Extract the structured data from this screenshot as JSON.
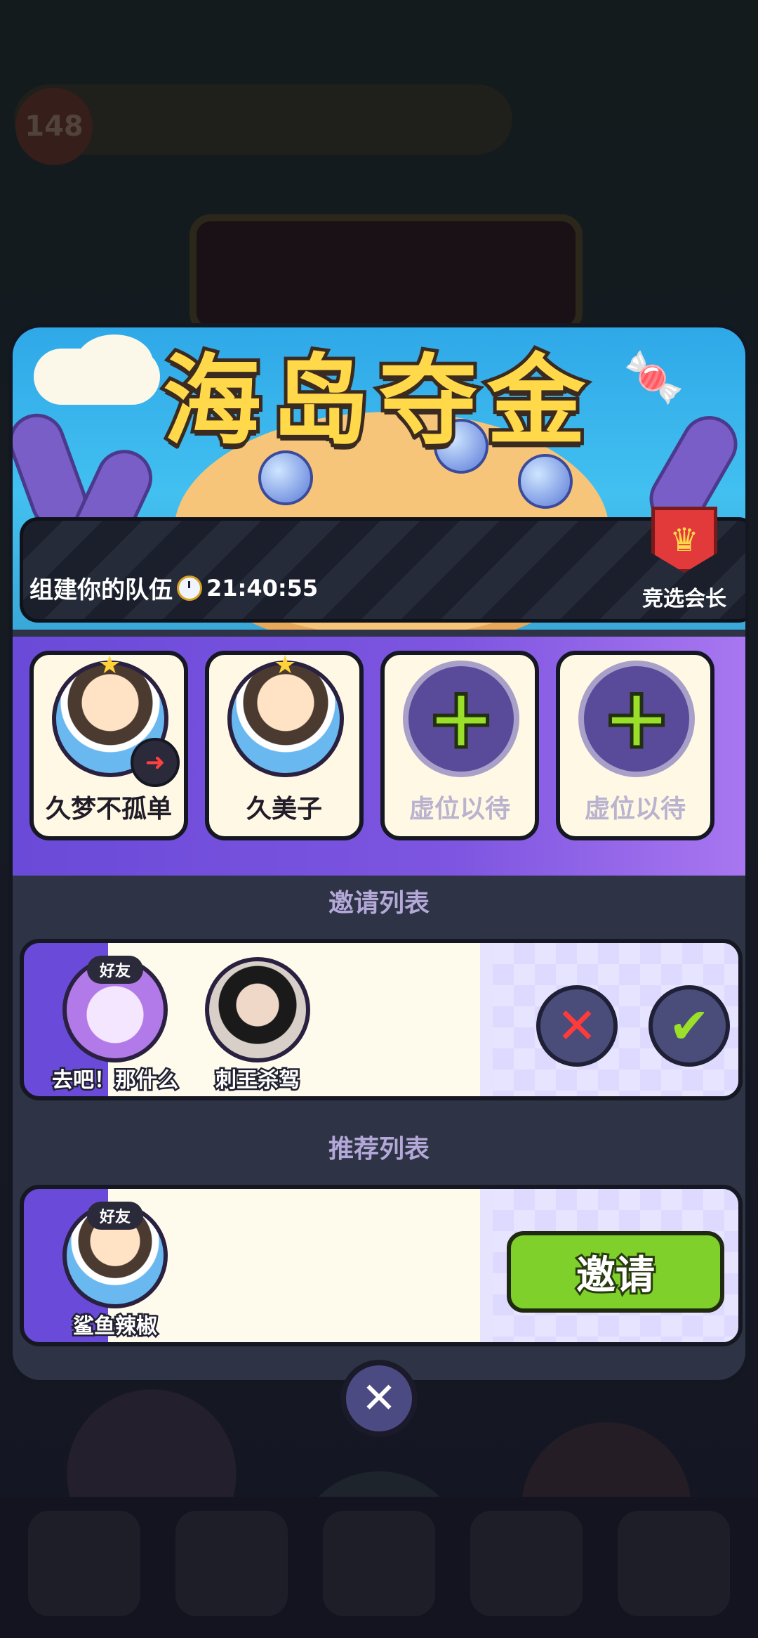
{
  "background": {
    "level": "148"
  },
  "event": {
    "title": "海岛夺金"
  },
  "team": {
    "label": "组建你的队伍",
    "timer": "21:40:55",
    "leader_label": "竞选会长",
    "slots": [
      {
        "name": "久梦不孤单",
        "filled": true
      },
      {
        "name": "久美子",
        "filled": true
      },
      {
        "name": "虚位以待",
        "filled": false
      },
      {
        "name": "虚位以待",
        "filled": false
      }
    ]
  },
  "invite_list": {
    "title": "邀请列表",
    "players": [
      {
        "name": "去吧！那什么",
        "tag": "好友"
      },
      {
        "name": "刺王杀驾"
      }
    ]
  },
  "recommend_list": {
    "title": "推荐列表",
    "players": [
      {
        "name": "鲨鱼辣椒",
        "tag": "好友"
      }
    ],
    "invite_label": "邀请"
  },
  "icons": {
    "close": "close-icon",
    "clock": "clock-icon",
    "plus": "plus-icon",
    "reject": "x-icon",
    "accept": "check-icon",
    "leader": "crown-shield-icon"
  },
  "colors": {
    "accent_green": "#7fd02a",
    "title_yellow": "#ffd94a",
    "purple": "#6a4ad8"
  }
}
